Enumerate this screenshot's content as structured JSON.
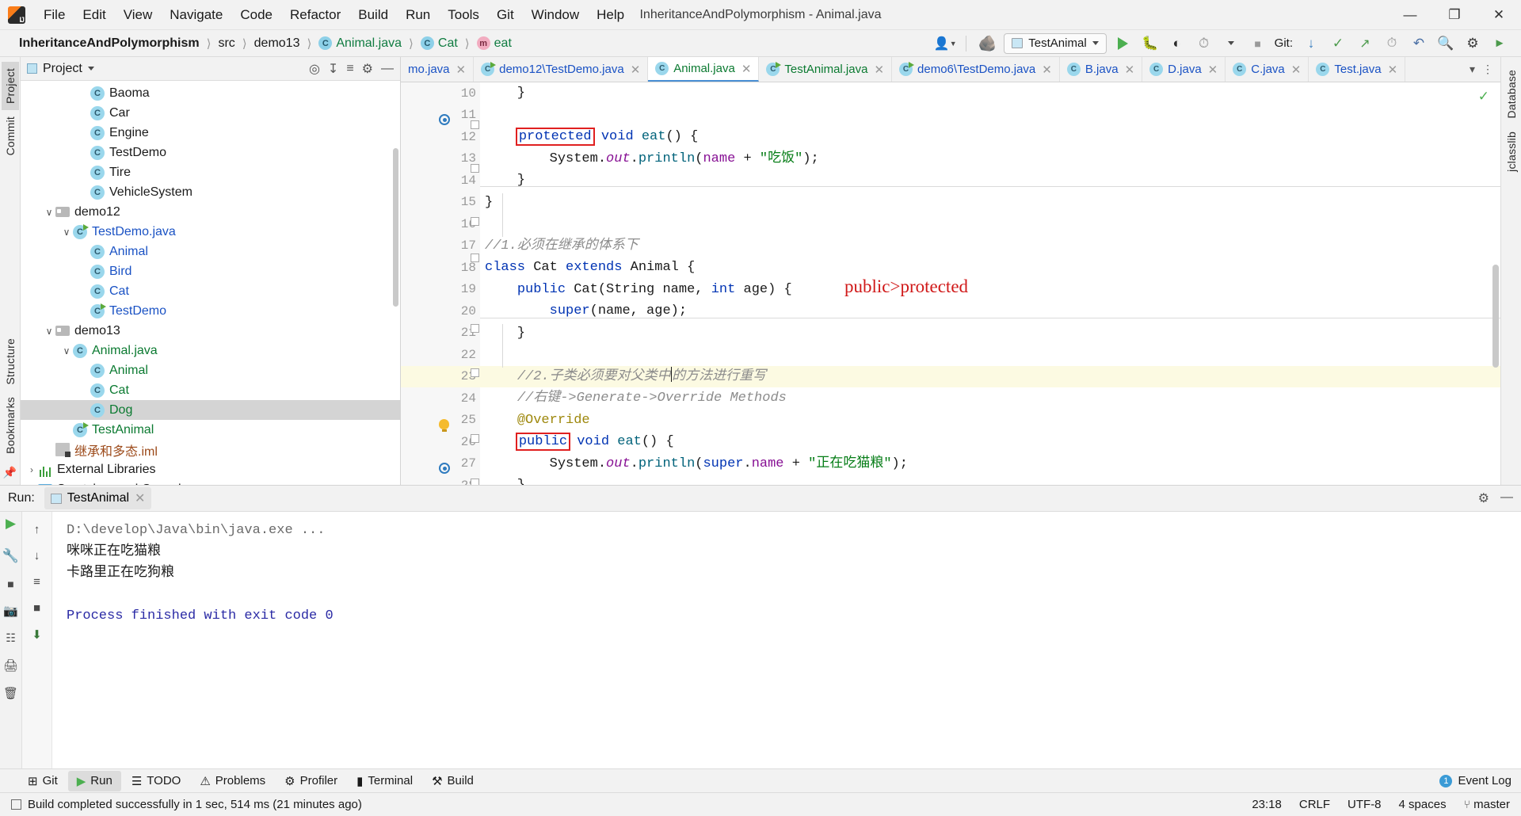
{
  "titlebar": {
    "window_title": "InheritanceAndPolymorphism - Animal.java",
    "menus": [
      "File",
      "Edit",
      "View",
      "Navigate",
      "Code",
      "Refactor",
      "Build",
      "Run",
      "Tools",
      "Git",
      "Window",
      "Help"
    ],
    "minimize": "—",
    "maximize": "❐",
    "close": "✕"
  },
  "navbar": {
    "breadcrumbs": [
      {
        "label": "InheritanceAndPolymorphism",
        "icon": "",
        "style": "bold"
      },
      {
        "label": "src",
        "icon": "",
        "style": "plain"
      },
      {
        "label": "demo13",
        "icon": "",
        "style": "plain"
      },
      {
        "label": "Animal.java",
        "icon": "class-icon",
        "style": "green"
      },
      {
        "label": "Cat",
        "icon": "class-icon",
        "style": "green"
      },
      {
        "label": "eat",
        "icon": "method-icon",
        "style": "green"
      }
    ],
    "separator": "❯",
    "run_config": "TestAnimal",
    "git_label": "Git:",
    "icons": [
      "user-dropdown-icon",
      "build-hammer-icon",
      "run-icon",
      "debug-icon",
      "run-coverage-icon",
      "profiler-icon",
      "stop-icon",
      "git-update-icon",
      "git-commit-icon",
      "git-push-icon",
      "history-icon",
      "undo-icon",
      "search-icon",
      "settings-icon",
      "run-anything-icon"
    ]
  },
  "left_strip": {
    "tabs": [
      "Project",
      "Commit"
    ],
    "bottom": [
      "Structure",
      "Bookmarks"
    ]
  },
  "right_strip": {
    "tabs": [
      "Database",
      "jclasslib"
    ]
  },
  "project_panel": {
    "title": "Project",
    "header_icons": [
      "locate-icon",
      "collapse-all-icon",
      "expand-icon",
      "settings-icon",
      "hide-icon"
    ],
    "tree": [
      {
        "indent": 3,
        "arrow": "",
        "icon": "class-icon",
        "label": "Baoma",
        "color": "dark",
        "selected": false
      },
      {
        "indent": 3,
        "arrow": "",
        "icon": "class-icon",
        "label": "Car",
        "color": "dark",
        "selected": false
      },
      {
        "indent": 3,
        "arrow": "",
        "icon": "class-icon",
        "label": "Engine",
        "color": "dark",
        "selected": false
      },
      {
        "indent": 3,
        "arrow": "",
        "icon": "class-icon",
        "label": "TestDemo",
        "color": "dark",
        "selected": false
      },
      {
        "indent": 3,
        "arrow": "",
        "icon": "class-icon",
        "label": "Tire",
        "color": "dark",
        "selected": false
      },
      {
        "indent": 3,
        "arrow": "",
        "icon": "class-icon",
        "label": "VehicleSystem",
        "color": "dark",
        "selected": false
      },
      {
        "indent": 1,
        "arrow": "∨",
        "icon": "folder-icon",
        "label": "demo12",
        "color": "dark",
        "selected": false
      },
      {
        "indent": 2,
        "arrow": "∨",
        "icon": "class-run-icon",
        "label": "TestDemo.java",
        "color": "blue",
        "selected": false
      },
      {
        "indent": 3,
        "arrow": "",
        "icon": "class-icon",
        "label": "Animal",
        "color": "blue",
        "selected": false
      },
      {
        "indent": 3,
        "arrow": "",
        "icon": "class-icon",
        "label": "Bird",
        "color": "blue",
        "selected": false
      },
      {
        "indent": 3,
        "arrow": "",
        "icon": "class-icon",
        "label": "Cat",
        "color": "blue",
        "selected": false
      },
      {
        "indent": 3,
        "arrow": "",
        "icon": "class-run-icon",
        "label": "TestDemo",
        "color": "blue",
        "selected": false
      },
      {
        "indent": 1,
        "arrow": "∨",
        "icon": "folder-icon",
        "label": "demo13",
        "color": "dark",
        "selected": false
      },
      {
        "indent": 2,
        "arrow": "∨",
        "icon": "class-icon",
        "label": "Animal.java",
        "color": "green",
        "selected": false
      },
      {
        "indent": 3,
        "arrow": "",
        "icon": "class-icon",
        "label": "Animal",
        "color": "green",
        "selected": false
      },
      {
        "indent": 3,
        "arrow": "",
        "icon": "class-icon",
        "label": "Cat",
        "color": "green",
        "selected": false
      },
      {
        "indent": 3,
        "arrow": "",
        "icon": "class-icon",
        "label": "Dog",
        "color": "green",
        "selected": true
      },
      {
        "indent": 2,
        "arrow": "",
        "icon": "class-run-icon",
        "label": "TestAnimal",
        "color": "green",
        "selected": false
      },
      {
        "indent": 1,
        "arrow": "",
        "icon": "iml-icon",
        "label": "继承和多态.iml",
        "color": "brown",
        "selected": false
      },
      {
        "indent": 0,
        "arrow": "›",
        "icon": "library-icon",
        "label": "External Libraries",
        "color": "dark",
        "selected": false
      },
      {
        "indent": 0,
        "arrow": "",
        "icon": "scratches-icon",
        "label": "Scratches and Consoles",
        "color": "dark",
        "selected": false
      }
    ]
  },
  "editor": {
    "tabs": [
      {
        "label": "mo.java",
        "icon": "class-icon",
        "color": "blue",
        "active": false,
        "truncated": true
      },
      {
        "label": "demo12\\TestDemo.java",
        "icon": "class-run-icon",
        "color": "blue",
        "active": false
      },
      {
        "label": "Animal.java",
        "icon": "class-icon",
        "color": "green",
        "active": true
      },
      {
        "label": "TestAnimal.java",
        "icon": "class-run-icon",
        "color": "green",
        "active": false
      },
      {
        "label": "demo6\\TestDemo.java",
        "icon": "class-run-icon",
        "color": "blue",
        "active": false
      },
      {
        "label": "B.java",
        "icon": "class-icon",
        "color": "blue",
        "active": false
      },
      {
        "label": "D.java",
        "icon": "class-icon",
        "color": "blue",
        "active": false
      },
      {
        "label": "C.java",
        "icon": "class-icon",
        "color": "blue",
        "active": false
      },
      {
        "label": "Test.java",
        "icon": "class-icon",
        "color": "blue",
        "active": false
      }
    ],
    "tab_close": "✕",
    "tabbar_right_icons": [
      "chevron-down-icon",
      "more-options-icon"
    ],
    "annotation": "public>protected",
    "lines": [
      {
        "n": 10,
        "text": "    }"
      },
      {
        "n": 11,
        "text": ""
      },
      {
        "n": 12,
        "text": "    protected void eat() {"
      },
      {
        "n": 13,
        "text": "        System.out.println(name + \"吃饭\");"
      },
      {
        "n": 14,
        "text": "    }"
      },
      {
        "n": 15,
        "text": "}"
      },
      {
        "n": 16,
        "text": ""
      },
      {
        "n": 17,
        "text": "//1.必须在继承的体系下"
      },
      {
        "n": 18,
        "text": "class Cat extends Animal {"
      },
      {
        "n": 19,
        "text": "    public Cat(String name, int age) {"
      },
      {
        "n": 20,
        "text": "        super(name, age);"
      },
      {
        "n": 21,
        "text": "    }"
      },
      {
        "n": 22,
        "text": ""
      },
      {
        "n": 23,
        "text": "    //2.子类必须要对父类中的方法进行重写"
      },
      {
        "n": 24,
        "text": "    //右键->Generate->Override Methods"
      },
      {
        "n": 25,
        "text": "    @Override"
      },
      {
        "n": 26,
        "text": "    public void eat() {"
      },
      {
        "n": 27,
        "text": "        System.out.println(super.name + \"正在吃猫粮\");"
      },
      {
        "n": 28,
        "text": "    }"
      }
    ]
  },
  "run_panel": {
    "label": "Run:",
    "tab": "TestAnimal",
    "close": "✕",
    "header_icons": [
      "settings-icon",
      "hide-icon"
    ],
    "side_icons": [
      "rerun-icon",
      "wrench-icon",
      "stop-icon",
      "resume-icon",
      "camera-icon",
      "download-icon",
      "scroll-icon",
      "print-icon",
      "trash-icon",
      "soft-wrap-icon",
      "up-icon",
      "down-icon"
    ],
    "console": [
      {
        "text": "D:\\develop\\Java\\bin\\java.exe ...",
        "style": "grey"
      },
      {
        "text": "咪咪正在吃猫粮",
        "style": "out"
      },
      {
        "text": "卡路里正在吃狗粮",
        "style": "out"
      },
      {
        "text": "",
        "style": "out"
      },
      {
        "text": "Process finished with exit code 0",
        "style": "fin"
      }
    ]
  },
  "bottom_toolbar": {
    "items": [
      {
        "label": "Git",
        "icon": "git-icon",
        "selected": false
      },
      {
        "label": "Run",
        "icon": "run-icon",
        "selected": true
      },
      {
        "label": "TODO",
        "icon": "todo-icon",
        "selected": false
      },
      {
        "label": "Problems",
        "icon": "problems-icon",
        "selected": false
      },
      {
        "label": "Profiler",
        "icon": "profiler-icon",
        "selected": false
      },
      {
        "label": "Terminal",
        "icon": "terminal-icon",
        "selected": false
      },
      {
        "label": "Build",
        "icon": "build-icon",
        "selected": false
      }
    ],
    "event_log": "Event Log",
    "event_badge": "1"
  },
  "statusbar": {
    "message": "Build completed successfully in 1 sec, 514 ms (21 minutes ago)",
    "position": "23:18",
    "line_sep": "CRLF",
    "encoding": "UTF-8",
    "indent": "4 spaces",
    "branch": "master",
    "branch_icon": "git-branch-icon"
  },
  "colors": {
    "accent": "#4a8fd4",
    "run_green": "#4caf50",
    "annotation_red": "#d01818",
    "keyword_blue": "#0033b3",
    "string_green": "#067d17",
    "comment_grey": "#8c8c8c"
  }
}
